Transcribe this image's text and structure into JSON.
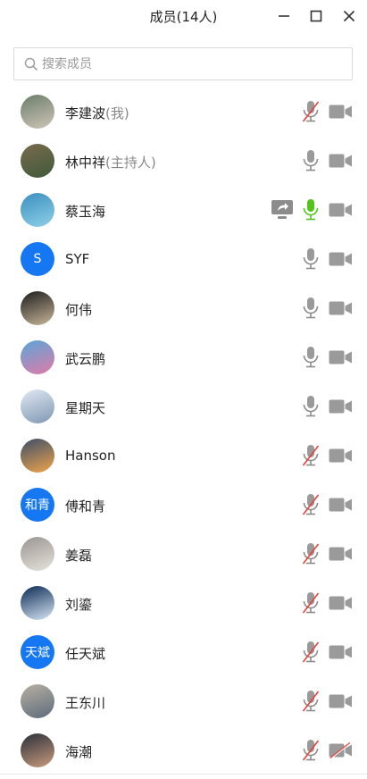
{
  "window": {
    "title": "成员(14人)"
  },
  "search": {
    "placeholder": "搜索成员"
  },
  "members": [
    {
      "name": "李建波",
      "suffix": "(我)",
      "avatar": "photo",
      "mic": "muted",
      "cam": "off"
    },
    {
      "name": "林中祥",
      "suffix": "(主持人)",
      "avatar": "photo",
      "mic": "on",
      "cam": "off"
    },
    {
      "name": "蔡玉海",
      "suffix": "",
      "avatar": "photo",
      "mic": "speaking",
      "cam": "off",
      "sharing": true
    },
    {
      "name": "SYF",
      "suffix": "",
      "avatar": "letter",
      "avatar_text": "S",
      "mic": "on",
      "cam": "off"
    },
    {
      "name": "何伟",
      "suffix": "",
      "avatar": "photo",
      "mic": "on",
      "cam": "off"
    },
    {
      "name": "武云鹏",
      "suffix": "",
      "avatar": "photo",
      "mic": "on",
      "cam": "off"
    },
    {
      "name": "星期天",
      "suffix": "",
      "avatar": "photo",
      "mic": "on",
      "cam": "off"
    },
    {
      "name": "Hanson",
      "suffix": "",
      "avatar": "photo",
      "mic": "muted",
      "cam": "off"
    },
    {
      "name": "傅和青",
      "suffix": "",
      "avatar": "letter",
      "avatar_text": "和青",
      "mic": "muted",
      "cam": "off"
    },
    {
      "name": "姜磊",
      "suffix": "",
      "avatar": "photo",
      "mic": "muted",
      "cam": "off"
    },
    {
      "name": "刘鎏",
      "suffix": "",
      "avatar": "photo",
      "mic": "muted",
      "cam": "off"
    },
    {
      "name": "任天斌",
      "suffix": "",
      "avatar": "letter",
      "avatar_text": "天斌",
      "mic": "muted",
      "cam": "off"
    },
    {
      "name": "王东川",
      "suffix": "",
      "avatar": "photo",
      "mic": "muted",
      "cam": "off"
    },
    {
      "name": "海潮",
      "suffix": "",
      "avatar": "photo",
      "mic": "muted",
      "cam": "disabled"
    }
  ],
  "colors": {
    "accent": "#1677f2",
    "speaking": "#52c41a",
    "muted_slash": "#e8433a",
    "icon_gray": "#8c8c8c"
  }
}
